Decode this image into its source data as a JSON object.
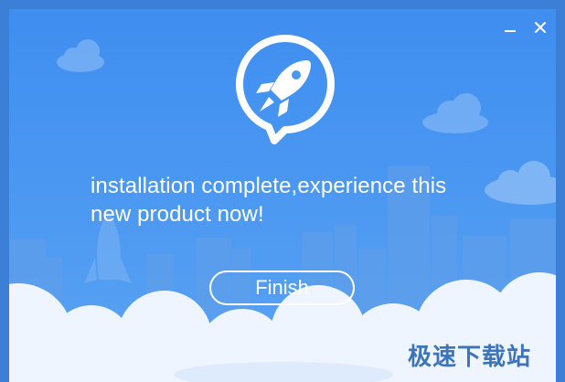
{
  "window": {
    "minimize_icon": "minimize-icon",
    "close_icon": "close-icon"
  },
  "logo": {
    "icon": "rocket-chat-bubble-logo"
  },
  "message": {
    "line1": "installation complete,experience this",
    "line2": "new product now!"
  },
  "finish_button": {
    "label": "Finish"
  },
  "watermark": {
    "text": "极速下载站"
  },
  "colors": {
    "background_blue": "#4a97f2",
    "text": "#ffffff",
    "cloud": "#e8f2fd",
    "watermark": "#1f5fae"
  }
}
